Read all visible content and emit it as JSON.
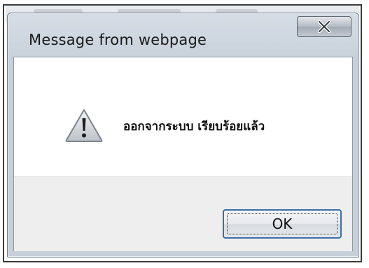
{
  "dialog": {
    "title": "Message from webpage",
    "close_icon": "close-x-icon",
    "message_icon": "warning-triangle-icon",
    "message": "ออกจากระบบ เรียบร้อยแล้ว",
    "ok_label": "OK"
  },
  "colors": {
    "titlebar": "#c7d0da",
    "footer": "#eeeeee",
    "button_border_focus": "#3c6ea6",
    "warning_fill": "#d9dde2"
  }
}
